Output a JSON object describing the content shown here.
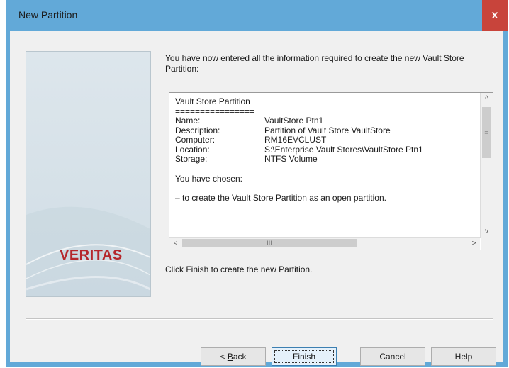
{
  "window": {
    "title": "New Partition",
    "close_glyph": "x"
  },
  "brand": {
    "logo_text": "VERITAS",
    "logo_color": "#b5272c"
  },
  "intro_text": "You have now entered all the information required to create the new Vault Store Partition:",
  "summary": {
    "heading": "Vault Store Partition",
    "separator": "================",
    "fields": [
      {
        "key": "Name:",
        "value": "VaultStore Ptn1"
      },
      {
        "key": "Description:",
        "value": "Partition of Vault Store VaultStore"
      },
      {
        "key": "Computer:",
        "value": "RM16EVCLUST"
      },
      {
        "key": "Location:",
        "value": "S:\\Enterprise Vault Stores\\VaultStore Ptn1"
      },
      {
        "key": "Storage:",
        "value": "NTFS Volume"
      }
    ],
    "chosen_label": "You have chosen:",
    "chosen_item": "– to create the Vault Store Partition as an open partition."
  },
  "footer_note": "Click Finish to create the new Partition.",
  "buttons": {
    "back_prefix": "< ",
    "back_mnemonic": "B",
    "back_rest": "ack",
    "finish": "Finish",
    "cancel": "Cancel",
    "help": "Help"
  },
  "scroll_glyphs": {
    "up": "^",
    "down": "v",
    "left": "<",
    "right": ">",
    "vgrip": "≡",
    "hgrip": "III"
  },
  "colors": {
    "title_bar": "#62a9d8",
    "close_button": "#c8443b",
    "dialog_background": "#f0f0f0"
  }
}
